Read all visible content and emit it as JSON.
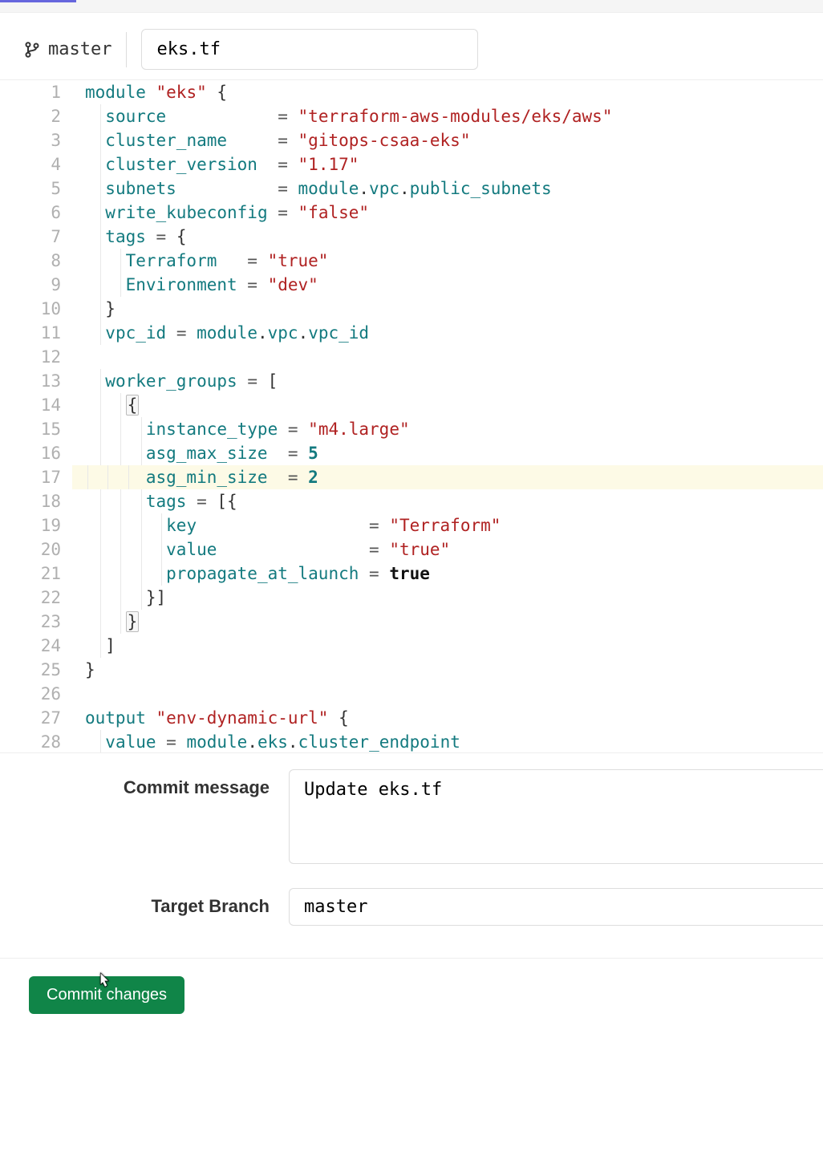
{
  "header": {
    "branch": "master",
    "filename": "eks.tf"
  },
  "editor": {
    "highlight_line": 17,
    "lines": [
      {
        "n": 1,
        "indent": 0,
        "tokens": [
          [
            "kw",
            "module "
          ],
          [
            "str",
            "\"eks\""
          ],
          [
            "plain",
            " {"
          ]
        ]
      },
      {
        "n": 2,
        "indent": 1,
        "tokens": [
          [
            "attr",
            "source           "
          ],
          [
            "op",
            "= "
          ],
          [
            "str",
            "\"terraform-aws-modules/eks/aws\""
          ]
        ]
      },
      {
        "n": 3,
        "indent": 1,
        "tokens": [
          [
            "attr",
            "cluster_name     "
          ],
          [
            "op",
            "= "
          ],
          [
            "str",
            "\"gitops-csaa-eks\""
          ]
        ]
      },
      {
        "n": 4,
        "indent": 1,
        "tokens": [
          [
            "attr",
            "cluster_version  "
          ],
          [
            "op",
            "= "
          ],
          [
            "str",
            "\"1.17\""
          ]
        ]
      },
      {
        "n": 5,
        "indent": 1,
        "tokens": [
          [
            "attr",
            "subnets          "
          ],
          [
            "op",
            "= "
          ],
          [
            "ref",
            "module"
          ],
          [
            "plain",
            "."
          ],
          [
            "ref",
            "vpc"
          ],
          [
            "plain",
            "."
          ],
          [
            "ref",
            "public_subnets"
          ]
        ]
      },
      {
        "n": 6,
        "indent": 1,
        "tokens": [
          [
            "attr",
            "write_kubeconfig "
          ],
          [
            "op",
            "= "
          ],
          [
            "str",
            "\"false\""
          ]
        ]
      },
      {
        "n": 7,
        "indent": 1,
        "tokens": [
          [
            "attr",
            "tags "
          ],
          [
            "op",
            "= "
          ],
          [
            "plain",
            "{"
          ]
        ]
      },
      {
        "n": 8,
        "indent": 2,
        "tokens": [
          [
            "attr",
            "Terraform   "
          ],
          [
            "op",
            "= "
          ],
          [
            "str",
            "\"true\""
          ]
        ]
      },
      {
        "n": 9,
        "indent": 2,
        "tokens": [
          [
            "attr",
            "Environment "
          ],
          [
            "op",
            "= "
          ],
          [
            "str",
            "\"dev\""
          ]
        ]
      },
      {
        "n": 10,
        "indent": 1,
        "tokens": [
          [
            "plain",
            "}"
          ]
        ]
      },
      {
        "n": 11,
        "indent": 1,
        "tokens": [
          [
            "attr",
            "vpc_id "
          ],
          [
            "op",
            "= "
          ],
          [
            "ref",
            "module"
          ],
          [
            "plain",
            "."
          ],
          [
            "ref",
            "vpc"
          ],
          [
            "plain",
            "."
          ],
          [
            "ref",
            "vpc_id"
          ]
        ]
      },
      {
        "n": 12,
        "indent": 0,
        "tokens": []
      },
      {
        "n": 13,
        "indent": 1,
        "tokens": [
          [
            "attr",
            "worker_groups "
          ],
          [
            "op",
            "= "
          ],
          [
            "plain",
            "["
          ]
        ]
      },
      {
        "n": 14,
        "indent": 2,
        "boxed": true,
        "tokens": [
          [
            "plain",
            "{"
          ]
        ]
      },
      {
        "n": 15,
        "indent": 3,
        "tokens": [
          [
            "attr",
            "instance_type "
          ],
          [
            "op",
            "= "
          ],
          [
            "str",
            "\"m4.large\""
          ]
        ]
      },
      {
        "n": 16,
        "indent": 3,
        "tokens": [
          [
            "attr",
            "asg_max_size  "
          ],
          [
            "op",
            "= "
          ],
          [
            "num",
            "5"
          ]
        ]
      },
      {
        "n": 17,
        "indent": 3,
        "tokens": [
          [
            "attr",
            "asg_min_size  "
          ],
          [
            "op",
            "= "
          ],
          [
            "num",
            "2"
          ]
        ]
      },
      {
        "n": 18,
        "indent": 3,
        "tokens": [
          [
            "attr",
            "tags "
          ],
          [
            "op",
            "= "
          ],
          [
            "plain",
            "[{"
          ]
        ]
      },
      {
        "n": 19,
        "indent": 4,
        "tokens": [
          [
            "attr",
            "key                 "
          ],
          [
            "op",
            "= "
          ],
          [
            "str",
            "\"Terraform\""
          ]
        ]
      },
      {
        "n": 20,
        "indent": 4,
        "tokens": [
          [
            "attr",
            "value               "
          ],
          [
            "op",
            "= "
          ],
          [
            "str",
            "\"true\""
          ]
        ]
      },
      {
        "n": 21,
        "indent": 4,
        "tokens": [
          [
            "attr",
            "propagate_at_launch "
          ],
          [
            "op",
            "= "
          ],
          [
            "bool",
            "true"
          ]
        ]
      },
      {
        "n": 22,
        "indent": 3,
        "tokens": [
          [
            "plain",
            "}]"
          ]
        ]
      },
      {
        "n": 23,
        "indent": 2,
        "boxed": true,
        "tokens": [
          [
            "plain",
            "}"
          ]
        ]
      },
      {
        "n": 24,
        "indent": 1,
        "tokens": [
          [
            "plain",
            "]"
          ]
        ]
      },
      {
        "n": 25,
        "indent": 0,
        "tokens": [
          [
            "plain",
            "}"
          ]
        ]
      },
      {
        "n": 26,
        "indent": 0,
        "tokens": []
      },
      {
        "n": 27,
        "indent": 0,
        "tokens": [
          [
            "kw",
            "output "
          ],
          [
            "str",
            "\"env-dynamic-url\""
          ],
          [
            "plain",
            " {"
          ]
        ]
      },
      {
        "n": 28,
        "indent": 1,
        "tokens": [
          [
            "attr",
            "value "
          ],
          [
            "op",
            "= "
          ],
          [
            "ref",
            "module"
          ],
          [
            "plain",
            "."
          ],
          [
            "ref",
            "eks"
          ],
          [
            "plain",
            "."
          ],
          [
            "ref",
            "cluster_endpoint"
          ]
        ]
      }
    ]
  },
  "form": {
    "commit_label": "Commit message",
    "commit_value": "Update eks.tf",
    "branch_label": "Target Branch",
    "branch_value": "master",
    "button": "Commit changes"
  }
}
